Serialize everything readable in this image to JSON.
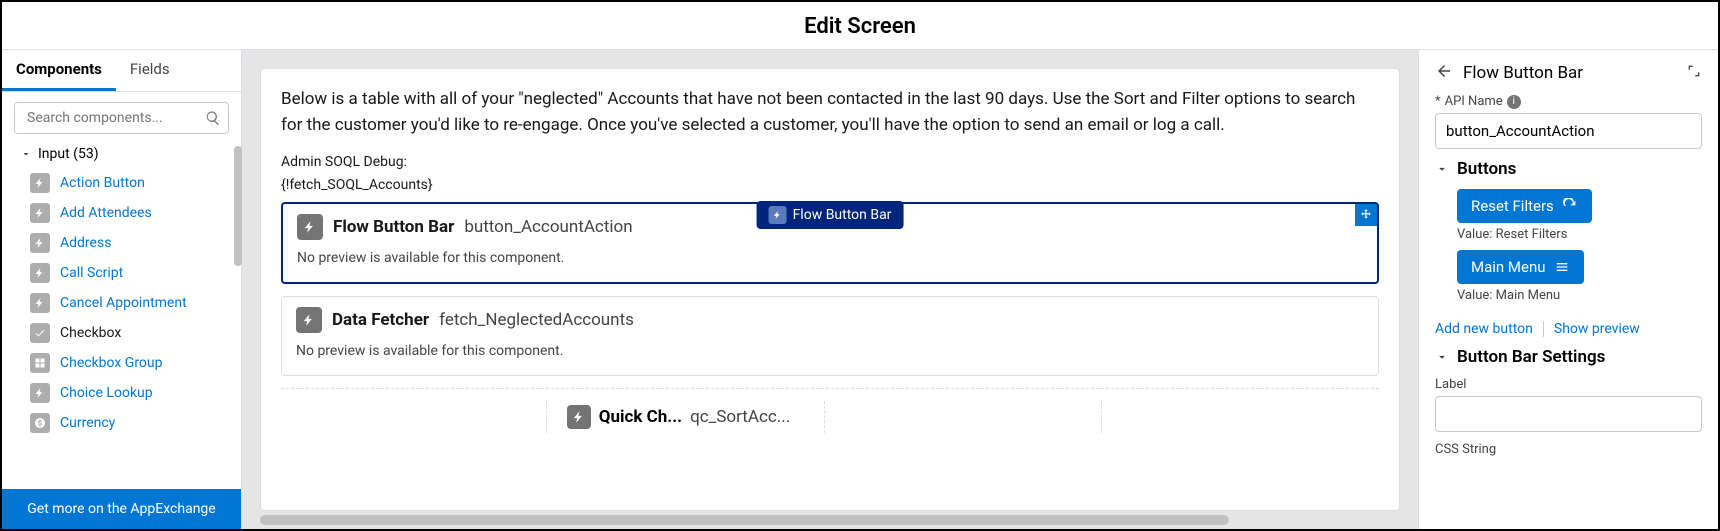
{
  "page_title": "Edit Screen",
  "left": {
    "tabs": {
      "components": "Components",
      "fields": "Fields"
    },
    "search_placeholder": "Search components...",
    "category_label": "Input (53)",
    "items": [
      {
        "label": "Action Button",
        "blue": true
      },
      {
        "label": "Add Attendees",
        "blue": true
      },
      {
        "label": "Address",
        "blue": true
      },
      {
        "label": "Call Script",
        "blue": true
      },
      {
        "label": "Cancel Appointment",
        "blue": true
      },
      {
        "label": "Checkbox",
        "blue": false
      },
      {
        "label": "Checkbox Group",
        "blue": true
      },
      {
        "label": "Choice Lookup",
        "blue": true
      },
      {
        "label": "Currency",
        "blue": true
      }
    ],
    "appexchange": "Get more on the AppExchange"
  },
  "canvas": {
    "intro": "Below is a table with all of your \"neglected\" Accounts that have not been contacted in the last 90 days. Use the Sort and Filter options to search for the customer you'd like to re-engage. Once you've selected a customer, you'll have the option to send an email or log a call.",
    "debug_label": "Admin SOQL Debug:",
    "debug_value": "{!fetch_SOQL_Accounts}",
    "floating_pill": "Flow Button Bar",
    "flow_bar": {
      "title": "Flow Button Bar",
      "api": "button_AccountAction",
      "no_preview": "No preview is available for this component."
    },
    "data_fetcher": {
      "title": "Data Fetcher",
      "api": "fetch_NeglectedAccounts",
      "no_preview": "No preview is available for this component."
    },
    "row_item": {
      "title": "Quick Ch...",
      "api": "qc_SortAcc..."
    }
  },
  "right": {
    "title": "Flow Button Bar",
    "api_label": "API Name",
    "api_value": "button_AccountAction",
    "buttons_section": "Buttons",
    "btn1": {
      "label": "Reset Filters",
      "value": "Value: Reset Filters"
    },
    "btn2": {
      "label": "Main Menu",
      "value": "Value: Main Menu"
    },
    "add_new": "Add new button",
    "show_preview": "Show preview",
    "settings_section": "Button Bar Settings",
    "label_field": "Label",
    "css_field": "CSS String"
  }
}
